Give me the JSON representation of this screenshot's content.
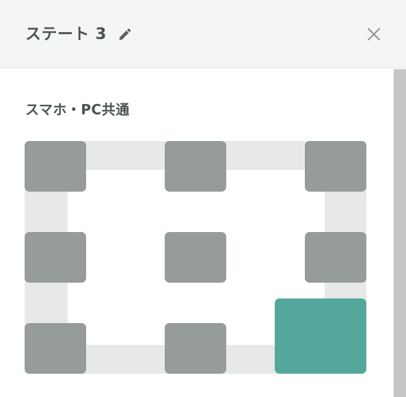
{
  "dialog": {
    "title": "ステート 3",
    "edit_icon": "pencil-icon",
    "close_icon": "close-icon"
  },
  "section": {
    "label": "スマホ・PC共通"
  },
  "position_grid": {
    "rows": 3,
    "columns": 3,
    "selected": "bottom-right",
    "colors": {
      "frame": "#e7e9e8",
      "cell": "#969c99",
      "selected_cell": "#54a79c"
    }
  }
}
